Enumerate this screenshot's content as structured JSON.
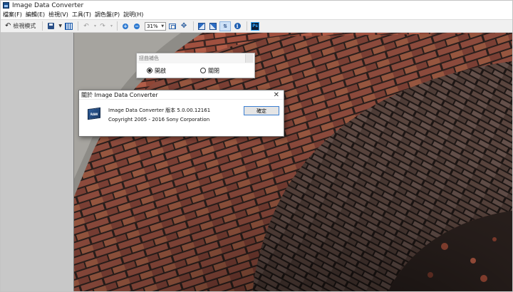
{
  "window": {
    "title": "Image Data Converter"
  },
  "menu": {
    "items": [
      "檔案(F)",
      "編輯(E)",
      "檢視(V)",
      "工具(T)",
      "調色盤(P)",
      "說明(H)"
    ]
  },
  "toolbar": {
    "review_mode_label": "檢視模式",
    "zoom_value": "31%"
  },
  "palette": {
    "title": "扭曲補色",
    "option_on": "開啟",
    "option_off": "關閉",
    "selected": "option_on"
  },
  "about_dialog": {
    "title": "關於 Image Data Converter",
    "version_text": "Image Data Converter 版本 5.0.00.12161",
    "copyright_text": "Copyright 2005 - 2016 Sony Corporation",
    "ok_label": "確定"
  },
  "icons": {
    "app": "app-icon",
    "review_mode": "undo-icon",
    "save": "save-icon",
    "save_dropdown": "chevron-down-icon",
    "grid": "thumbnail-grid-icon",
    "undo": "undo-arrow-icon",
    "redo": "redo-arrow-icon",
    "zoom_in": "zoom-in-icon",
    "zoom_out": "zoom-out-icon",
    "fit": "fit-to-window-icon",
    "move": "move-icon",
    "rotate_left": "rotate-left-icon",
    "rotate_right": "rotate-right-icon",
    "sort": "sort-icon",
    "info": "info-icon",
    "photoshop": "photoshop-icon",
    "close": "close-icon"
  }
}
